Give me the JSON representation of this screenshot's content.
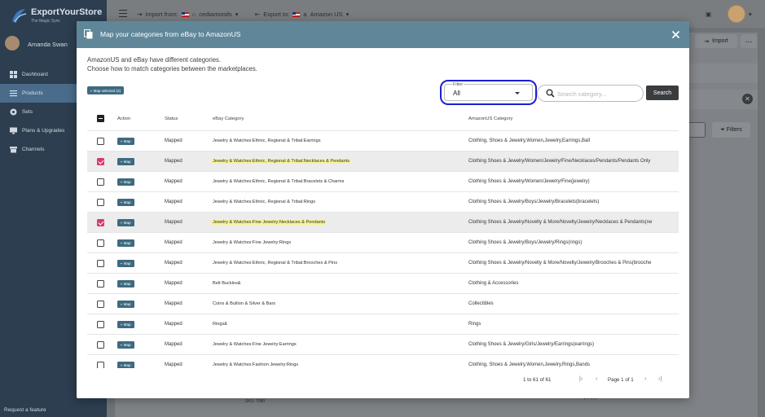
{
  "app": {
    "brand_name": "ExportYourStore",
    "brand_tagline": "The Magic Sync"
  },
  "sidebar": {
    "user_name": "Amanda Swan",
    "items": [
      {
        "label": "Dashboard",
        "icon": "dashboard-icon"
      },
      {
        "label": "Products",
        "icon": "list-icon"
      },
      {
        "label": "Sets",
        "icon": "sets-icon"
      },
      {
        "label": "Plans & Upgrades",
        "icon": "monitor-icon"
      },
      {
        "label": "Channels",
        "icon": "store-icon"
      }
    ],
    "request_feature": "Request a feature"
  },
  "topbar": {
    "import_from_label": "Import from:",
    "import_store": "cediamonds",
    "export_to_label": "Export to:",
    "export_store": "Amazon US"
  },
  "background": {
    "import_button": "Import",
    "more_button": "...",
    "filters_button": "Filters",
    "sku_text": "SKU: 7080",
    "fine_text": "Fine"
  },
  "modal": {
    "title": "Map your categories from eBay to AmazonUS",
    "intro_line1": "AmazonUS and eBay have different categories.",
    "intro_line2": "Choose how to match categories between the marketplaces.",
    "map_selected": "Map selected (2)",
    "filter_label": "Filter",
    "filter_value": "All",
    "search_placeholder": "Search category...",
    "search_button": "Search",
    "columns": {
      "action": "Action",
      "status": "Status",
      "ebay": "eBay Category",
      "amazon": "AmazonUS Category"
    },
    "map_label": "Map",
    "rows": [
      {
        "checked": false,
        "status": "Mapped",
        "ebay": "Jewelry & Watches:Ethnic, Regional & Tribal:Earrings",
        "amazon": "Clothing, Shoes & Jewelry,Women,Jewelry,Earrings,Ball"
      },
      {
        "checked": true,
        "status": "Mapped",
        "ebay": "Jewelry & Watches:Ethnic, Regional & Tribal:Necklaces & Pendants",
        "amazon": "Clothing Shoes & Jewelry/Women/Jewelry/Fine/Necklaces/Pendants/Pendants Only"
      },
      {
        "checked": false,
        "status": "Mapped",
        "ebay": "Jewelry & Watches:Ethnic, Regional & Tribal:Bracelets & Charms",
        "amazon": "Clothing Shoes & Jewelry/Women/Jewelry/Fine(jewelry)"
      },
      {
        "checked": false,
        "status": "Mapped",
        "ebay": "Jewelry & Watches:Ethnic, Regional & Tribal:Rings",
        "amazon": "Clothing Shoes & Jewelry/Boys/Jewelry/Bracelets(bracelets)"
      },
      {
        "checked": true,
        "status": "Mapped",
        "ebay": "Jewelry & Watches:Fine Jewelry:Necklaces & Pendants",
        "amazon": "Clothing Shoes & Jewelry/Novelty & More/Novelty/Jewelry/Necklaces & Pendants(ne"
      },
      {
        "checked": false,
        "status": "Mapped",
        "ebay": "Jewelry & Watches:Fine Jewelry:Rings",
        "amazon": "Clothing Shoes & Jewelry/Boys/Jewelry/Rings(rings)"
      },
      {
        "checked": false,
        "status": "Mapped",
        "ebay": "Jewelry & Watches:Ethnic, Regional & Tribal:Brooches & Pins",
        "amazon": "Clothing Shoes & Jewelry/Novelty & More/Novelty/Jewelry/Brooches & Pins(brooche"
      },
      {
        "checked": false,
        "status": "Mapped",
        "ebay": "Belt Buckles&",
        "amazon": "Clothing & Accessories"
      },
      {
        "checked": false,
        "status": "Mapped",
        "ebay": "Coins & Bullion & Silver & Bars",
        "amazon": "Collectibles"
      },
      {
        "checked": false,
        "status": "Mapped",
        "ebay": "Rings&",
        "amazon": "Rings"
      },
      {
        "checked": false,
        "status": "Mapped",
        "ebay": "Jewelry & Watches:Fine Jewelry:Earrings",
        "amazon": "Clothing Shoes & Jewelry/Girls/Jewelry/Earrings(earrings)"
      },
      {
        "checked": false,
        "status": "Mapped",
        "ebay": "Jewelry & Watches:Fashion Jewelry:Rings",
        "amazon": "Clothing, Shoes & Jewelry,Women,Jewelry,Rings,Bands"
      }
    ],
    "pagination": {
      "range": "1 to 61 of 61",
      "page_text": "Page 1 of 1"
    }
  },
  "colors": {
    "modal_header": "#5f8799",
    "map_button": "#3e6a80",
    "checkbox_checked": "#d83a6b",
    "highlight": "#f6f39a",
    "filter_ring": "#1c1fd0"
  }
}
